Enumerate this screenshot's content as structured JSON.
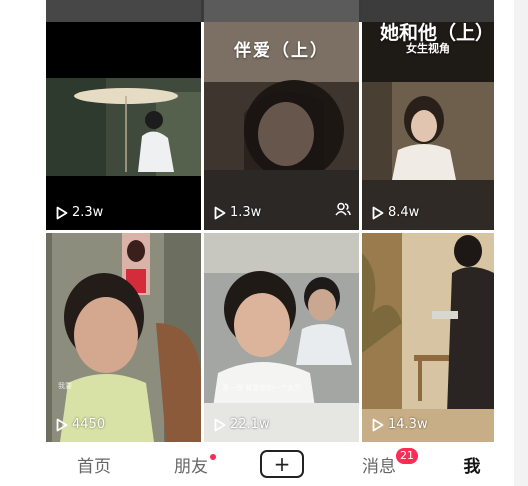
{
  "videos": [
    {
      "views": "2.3w",
      "title": ""
    },
    {
      "views": "1.3w",
      "title": "伴爱（上）",
      "friends_only": true
    },
    {
      "views": "8.4w",
      "title": "她和他（上）",
      "subtitle": "女生视角"
    },
    {
      "views": "4450",
      "caption": "我要"
    },
    {
      "views": "22.1w",
      "caption": "第一眼 就喜欢你一个女生"
    },
    {
      "views": "14.3w"
    }
  ],
  "nav": {
    "home": "首页",
    "friends": "朋友",
    "create": "+",
    "messages": "消息",
    "messages_badge": "21",
    "me": "我"
  },
  "colors": {
    "accent": "#fe2c55",
    "text_active": "#111111",
    "text_inactive": "#666666"
  }
}
